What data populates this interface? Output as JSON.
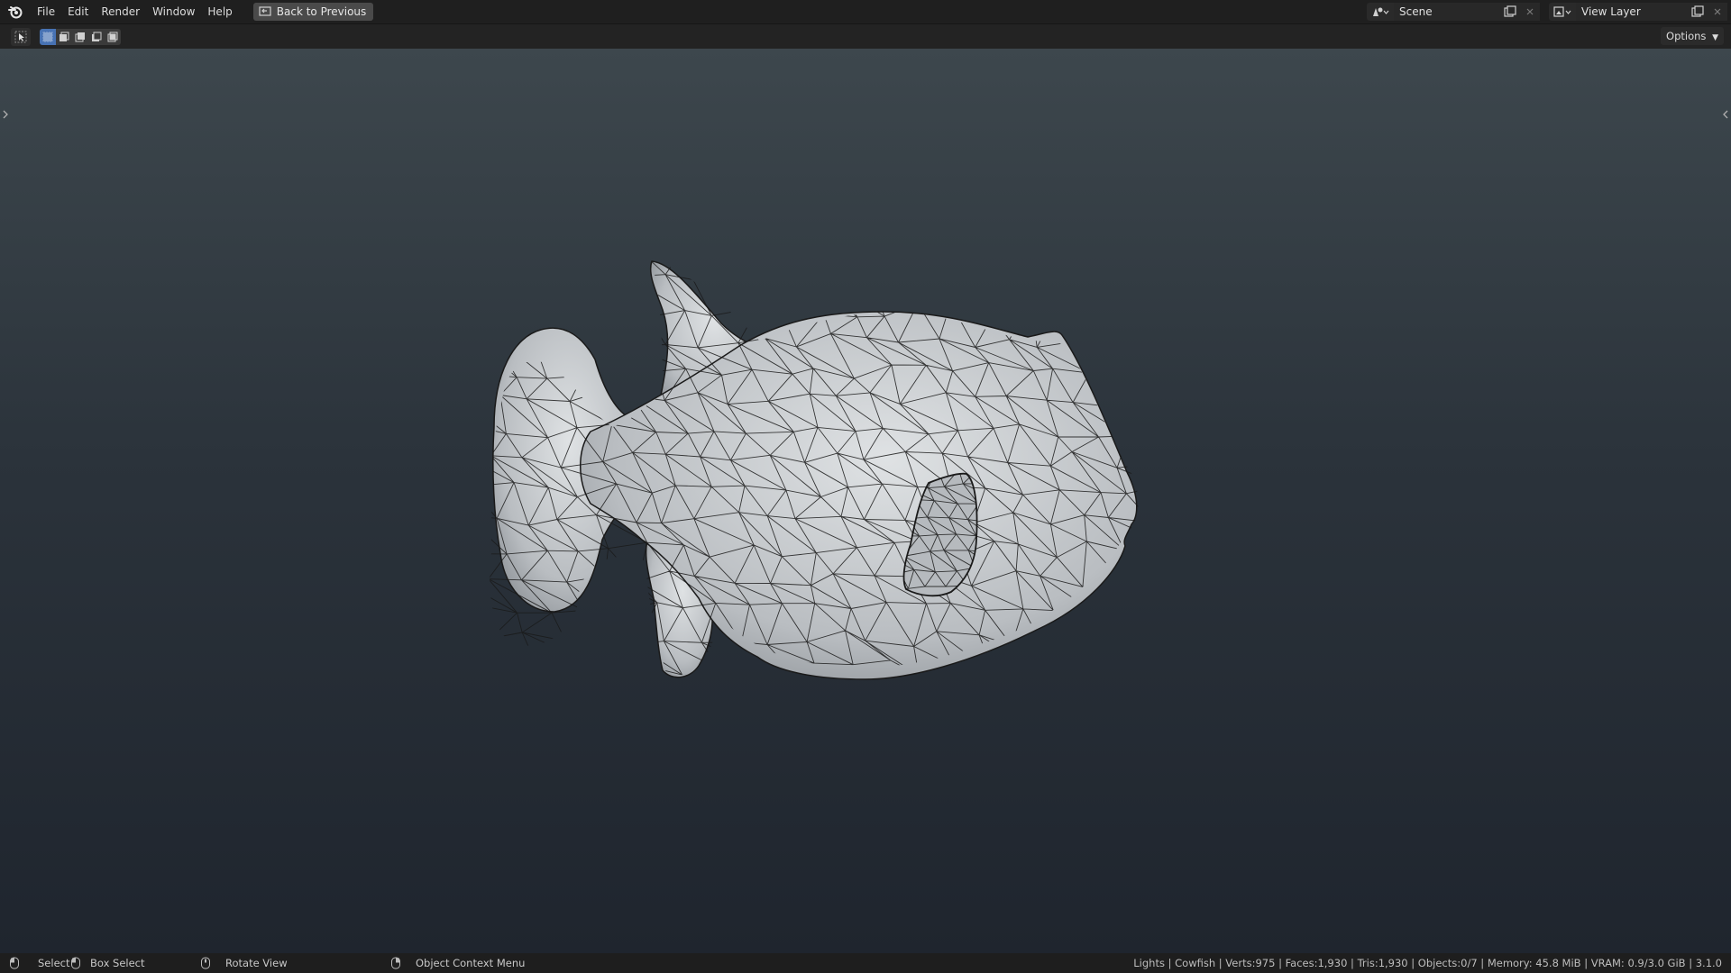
{
  "menu": {
    "items": [
      "File",
      "Edit",
      "Render",
      "Window",
      "Help"
    ],
    "back_label": "Back to Previous"
  },
  "scene": {
    "value": "Scene"
  },
  "view_layer": {
    "value": "View Layer"
  },
  "toolbar": {
    "options_label": "Options"
  },
  "statusbar": {
    "select": "Select",
    "box_select": "Box Select",
    "rotate_view": "Rotate View",
    "context_menu": "Object Context Menu",
    "stats": "Lights | Cowfish | Verts:975 | Faces:1,930 | Tris:1,930 | Objects:0/7 | Memory: 45.8 MiB | VRAM: 0.9/3.0 GiB | 3.1.0"
  },
  "colors": {
    "accent": "#4772b3",
    "mesh": "#c9cccf",
    "wire": "#1a1a1a"
  }
}
